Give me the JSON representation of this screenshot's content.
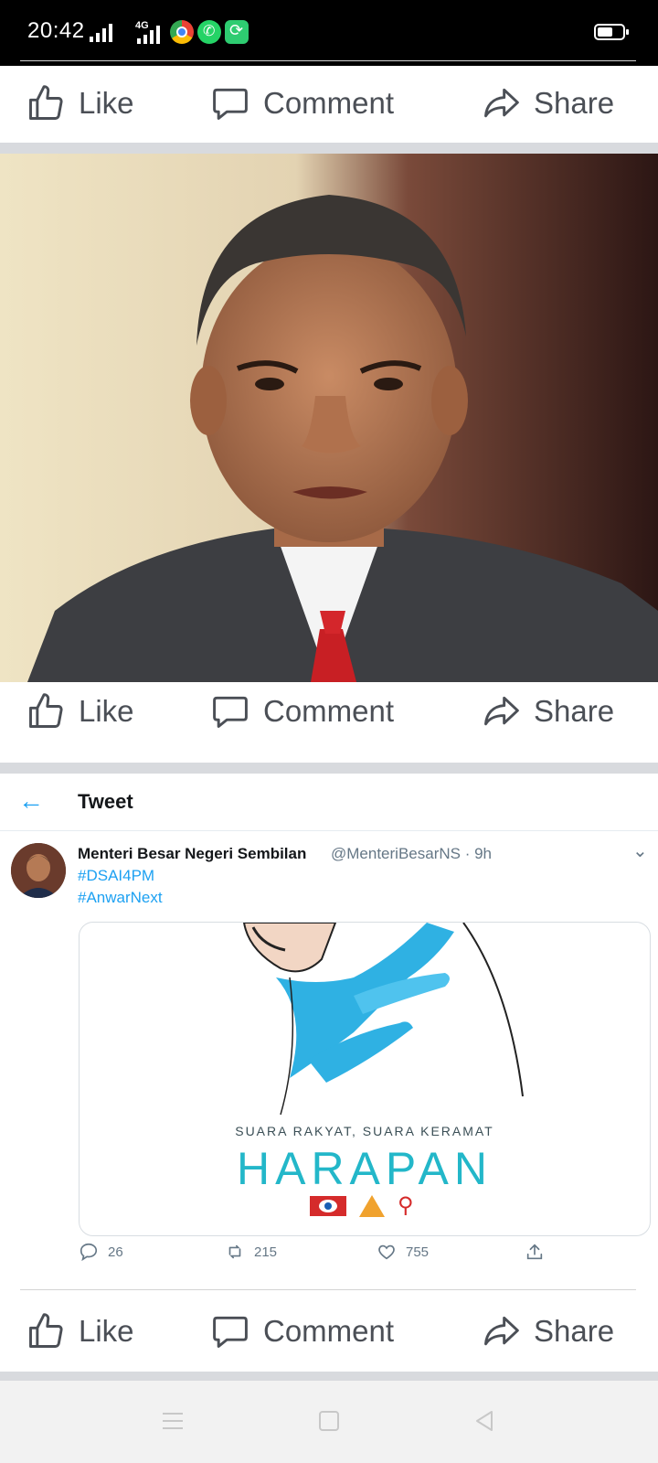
{
  "status_bar": {
    "time": "20:42",
    "network": "4G"
  },
  "actions": {
    "like": "Like",
    "comment": "Comment",
    "share": "Share"
  },
  "photo": {
    "description_icon": "portrait-photo"
  },
  "tweet": {
    "header_title": "Tweet",
    "author_name": "Menteri Besar Negeri Sembilan",
    "author_handle_time": "@MenteriBesarNS · 9h",
    "hashtags": [
      "#DSAI4PM",
      "#AnwarNext"
    ],
    "card": {
      "slogan": "SUARA RAKYAT, SUARA KERAMAT",
      "brand": "HARAPAN"
    },
    "stats": {
      "replies": "26",
      "retweets": "215",
      "likes": "755"
    }
  },
  "colors": {
    "twitter_blue": "#1da1f2",
    "harapan_teal": "#23b7c9",
    "action_gray": "#4b4f56"
  }
}
